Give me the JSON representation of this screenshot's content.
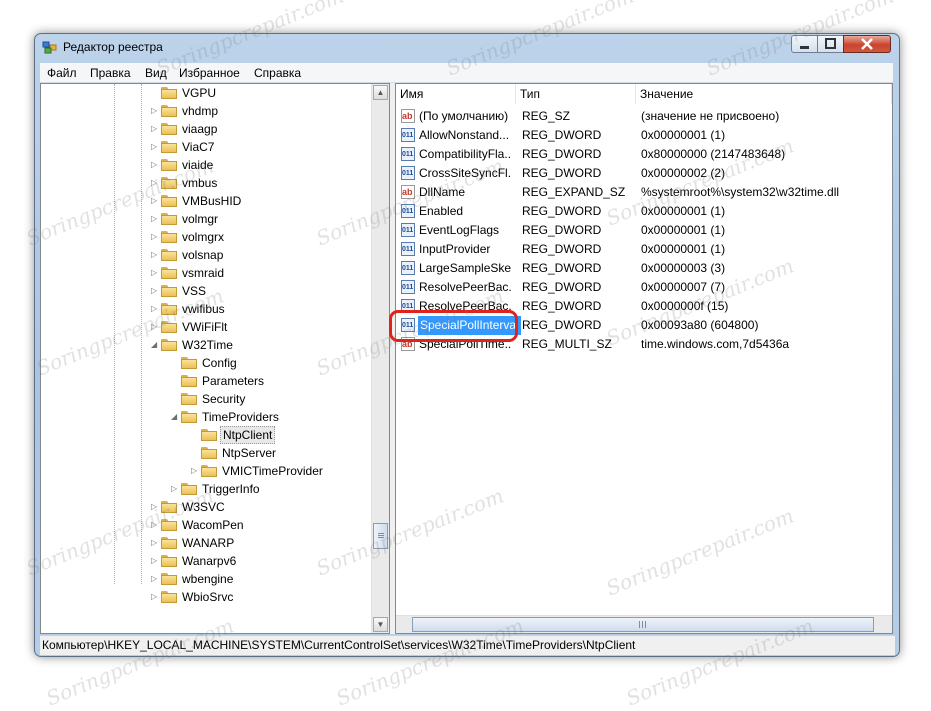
{
  "window": {
    "title": "Редактор реестра"
  },
  "menu": [
    "Файл",
    "Правка",
    "Вид",
    "Избранное",
    "Справка"
  ],
  "tree": {
    "nodes": [
      {
        "label": "VGPU",
        "level": 0,
        "expander": "none"
      },
      {
        "label": "vhdmp",
        "level": 0,
        "expander": "collapsed"
      },
      {
        "label": "viaagp",
        "level": 0,
        "expander": "collapsed"
      },
      {
        "label": "ViaC7",
        "level": 0,
        "expander": "collapsed"
      },
      {
        "label": "viaide",
        "level": 0,
        "expander": "collapsed"
      },
      {
        "label": "vmbus",
        "level": 0,
        "expander": "collapsed"
      },
      {
        "label": "VMBusHID",
        "level": 0,
        "expander": "collapsed"
      },
      {
        "label": "volmgr",
        "level": 0,
        "expander": "collapsed"
      },
      {
        "label": "volmgrx",
        "level": 0,
        "expander": "collapsed"
      },
      {
        "label": "volsnap",
        "level": 0,
        "expander": "collapsed"
      },
      {
        "label": "vsmraid",
        "level": 0,
        "expander": "collapsed"
      },
      {
        "label": "VSS",
        "level": 0,
        "expander": "collapsed"
      },
      {
        "label": "vwifibus",
        "level": 0,
        "expander": "collapsed"
      },
      {
        "label": "VWiFiFlt",
        "level": 0,
        "expander": "collapsed"
      },
      {
        "label": "W32Time",
        "level": 0,
        "expander": "expanded"
      },
      {
        "label": "Config",
        "level": 1,
        "expander": "none"
      },
      {
        "label": "Parameters",
        "level": 1,
        "expander": "none"
      },
      {
        "label": "Security",
        "level": 1,
        "expander": "none"
      },
      {
        "label": "TimeProviders",
        "level": 1,
        "expander": "expanded"
      },
      {
        "label": "NtpClient",
        "level": 2,
        "expander": "none",
        "selected": true
      },
      {
        "label": "NtpServer",
        "level": 2,
        "expander": "none"
      },
      {
        "label": "VMICTimeProvider",
        "level": 2,
        "expander": "collapsed"
      },
      {
        "label": "TriggerInfo",
        "level": 1,
        "expander": "collapsed"
      },
      {
        "label": "W3SVC",
        "level": 0,
        "expander": "collapsed"
      },
      {
        "label": "WacomPen",
        "level": 0,
        "expander": "collapsed"
      },
      {
        "label": "WANARP",
        "level": 0,
        "expander": "collapsed"
      },
      {
        "label": "Wanarpv6",
        "level": 0,
        "expander": "collapsed"
      },
      {
        "label": "wbengine",
        "level": 0,
        "expander": "collapsed"
      },
      {
        "label": "WbioSrvc",
        "level": 0,
        "expander": "collapsed"
      }
    ]
  },
  "list": {
    "columns": [
      "Имя",
      "Тип",
      "Значение"
    ],
    "rows": [
      {
        "name": "(По умолчанию)",
        "type": "REG_SZ",
        "data": "(значение не присвоено)",
        "icon": "string-value-icon",
        "kind": "sz"
      },
      {
        "name": "AllowNonstand...",
        "type": "REG_DWORD",
        "data": "0x00000001 (1)",
        "icon": "binary-value-icon",
        "kind": "bin"
      },
      {
        "name": "CompatibilityFla...",
        "type": "REG_DWORD",
        "data": "0x80000000 (2147483648)",
        "icon": "binary-value-icon",
        "kind": "bin"
      },
      {
        "name": "CrossSiteSyncFl...",
        "type": "REG_DWORD",
        "data": "0x00000002 (2)",
        "icon": "binary-value-icon",
        "kind": "bin"
      },
      {
        "name": "DllName",
        "type": "REG_EXPAND_SZ",
        "data": "%systemroot%\\system32\\w32time.dll",
        "icon": "string-value-icon",
        "kind": "sz"
      },
      {
        "name": "Enabled",
        "type": "REG_DWORD",
        "data": "0x00000001 (1)",
        "icon": "binary-value-icon",
        "kind": "bin"
      },
      {
        "name": "EventLogFlags",
        "type": "REG_DWORD",
        "data": "0x00000001 (1)",
        "icon": "binary-value-icon",
        "kind": "bin"
      },
      {
        "name": "InputProvider",
        "type": "REG_DWORD",
        "data": "0x00000001 (1)",
        "icon": "binary-value-icon",
        "kind": "bin"
      },
      {
        "name": "LargeSampleSkew",
        "type": "REG_DWORD",
        "data": "0x00000003 (3)",
        "icon": "binary-value-icon",
        "kind": "bin"
      },
      {
        "name": "ResolvePeerBac...",
        "type": "REG_DWORD",
        "data": "0x00000007 (7)",
        "icon": "binary-value-icon",
        "kind": "bin"
      },
      {
        "name": "ResolvePeerBac...",
        "type": "REG_DWORD",
        "data": "0x0000000f (15)",
        "icon": "binary-value-icon",
        "kind": "bin"
      },
      {
        "name": "SpecialPollInterval",
        "type": "REG_DWORD",
        "data": "0x00093a80 (604800)",
        "icon": "binary-value-icon",
        "kind": "bin",
        "selected": true
      },
      {
        "name": "SpecialPollTime...",
        "type": "REG_MULTI_SZ",
        "data": "time.windows.com,7d5436a",
        "icon": "string-value-icon",
        "kind": "sz"
      }
    ]
  },
  "statusbar": "Компьютер\\HKEY_LOCAL_MACHINE\\SYSTEM\\CurrentControlSet\\services\\W32Time\\TimeProviders\\NtpClient",
  "watermark": "Soringpcrepair.com"
}
